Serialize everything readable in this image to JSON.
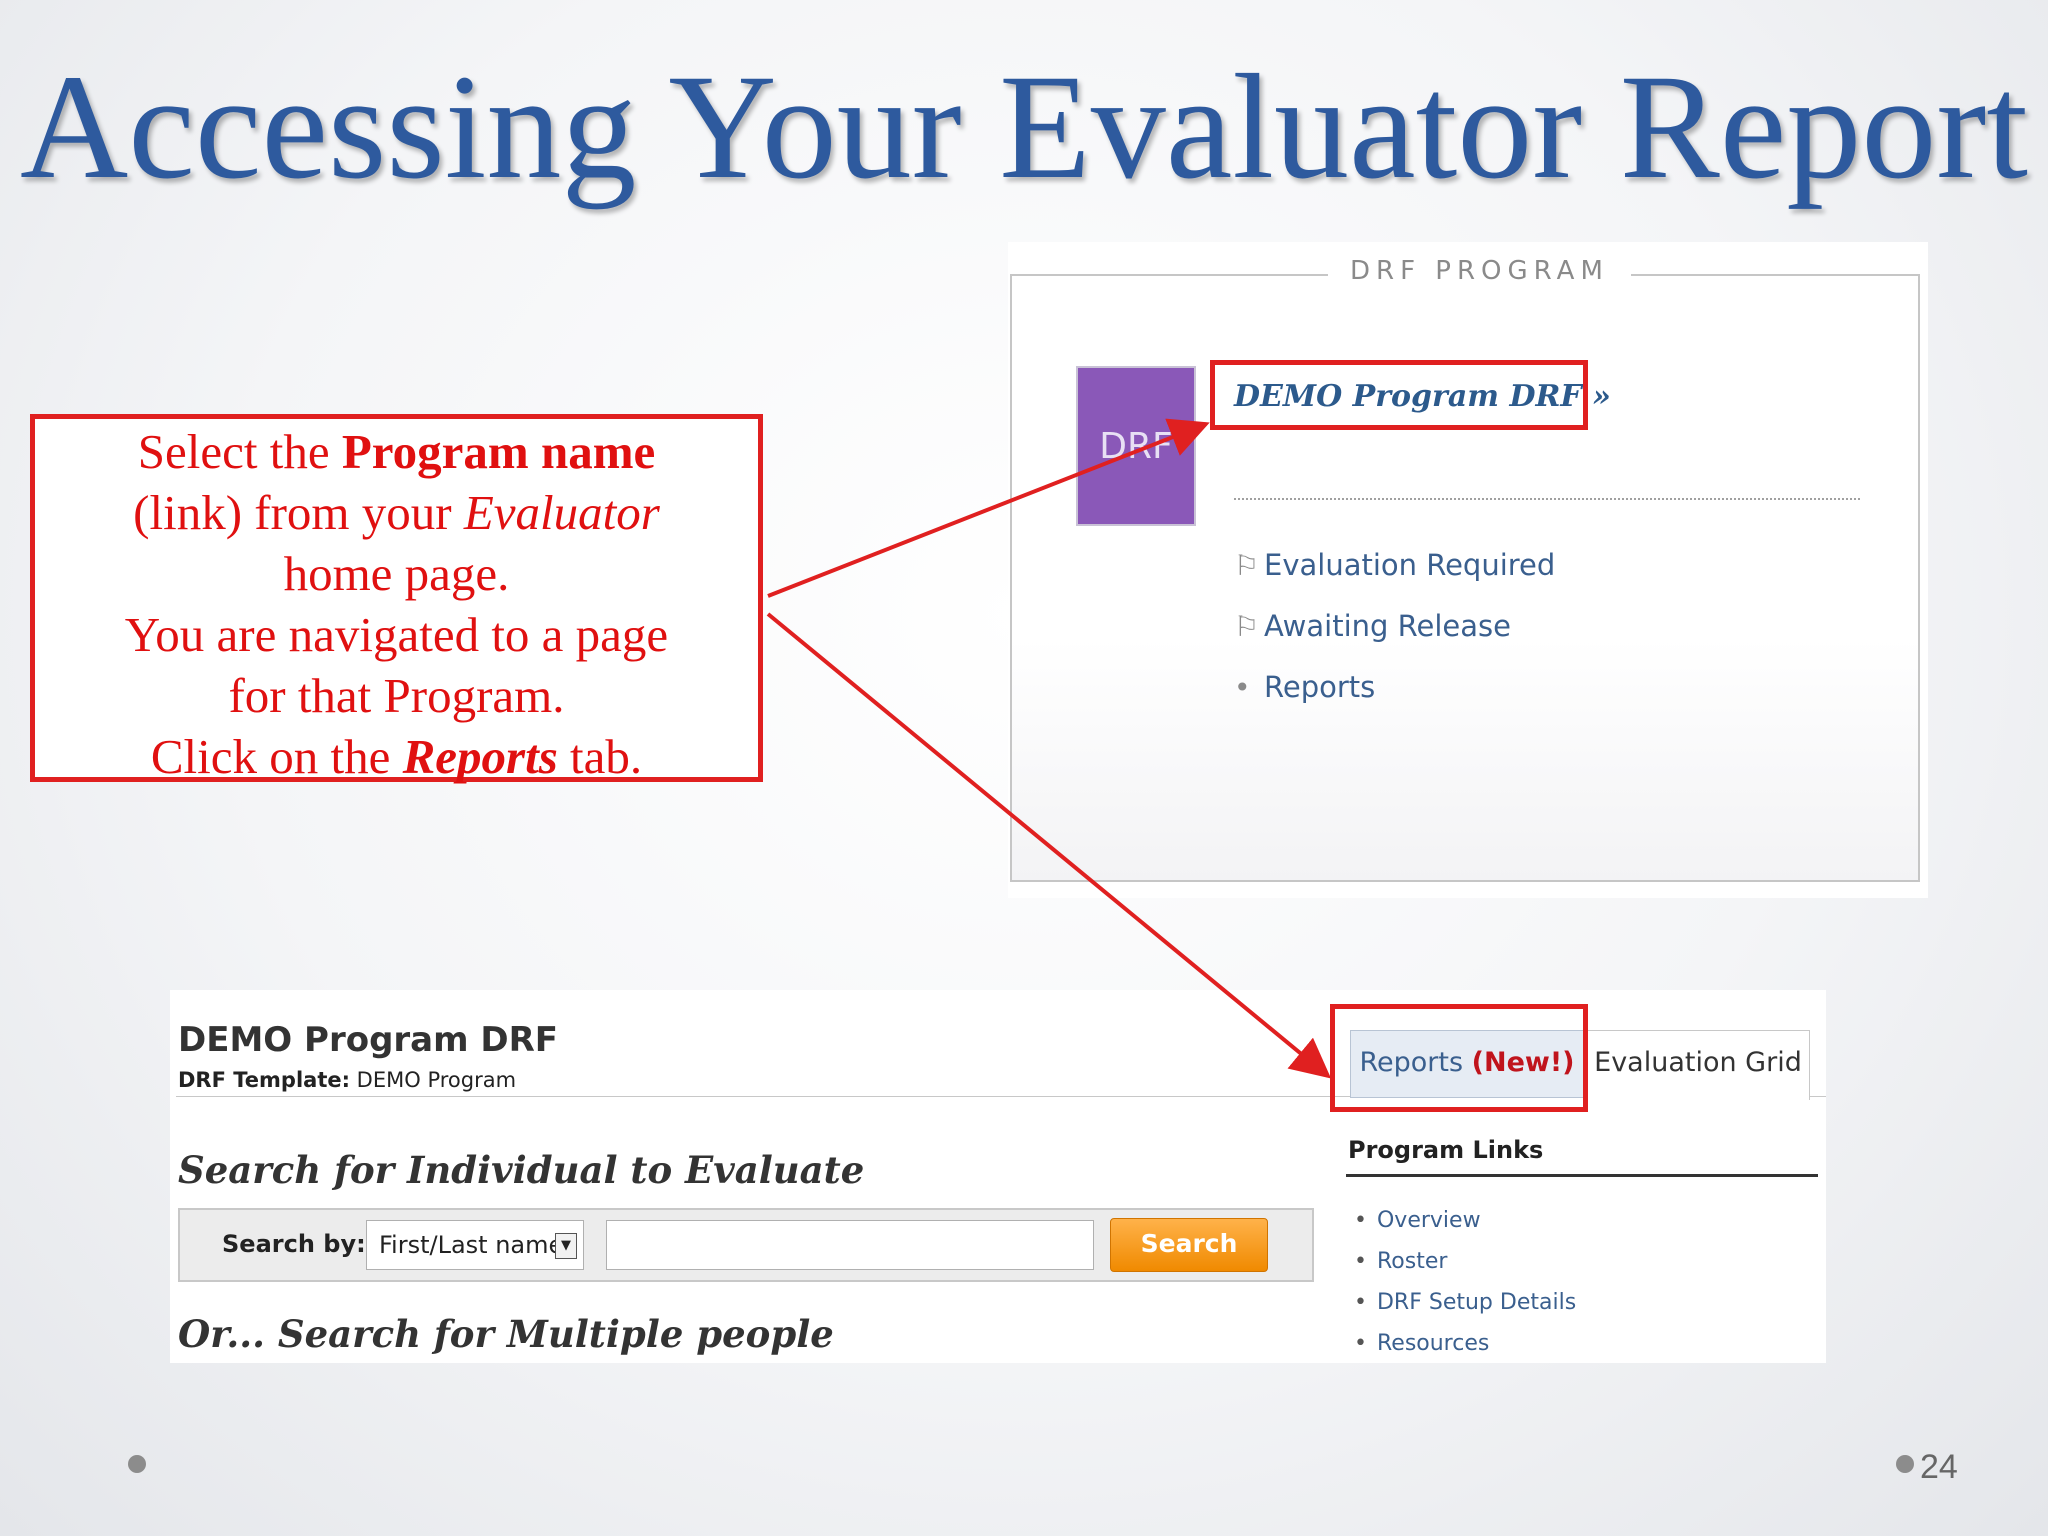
{
  "slide": {
    "title": "Accessing Your Evaluator Report",
    "page_number": "24"
  },
  "callout": {
    "line1_pre": "Select the ",
    "line1_bold": "Program name",
    "line2_pre": "(link) from your ",
    "line2_italic": "Evaluator",
    "line3": "home page.",
    "line4": "You are navigated to a page",
    "line5": "for that Program.",
    "line6_pre": "Click on the ",
    "line6_bold_italic": "Reports",
    "line6_post": " tab."
  },
  "drf_panel": {
    "legend": "DRF PROGRAM",
    "logo_text": "DRF",
    "program_link": "DEMO Program DRF »",
    "links": [
      {
        "label": "Evaluation Required",
        "icon": "flag-icon"
      },
      {
        "label": "Awaiting Release",
        "icon": "flag-icon"
      },
      {
        "label": "Reports",
        "icon": "bullet"
      }
    ]
  },
  "program_page": {
    "program_title": "DEMO Program DRF",
    "template_label": "DRF Template:",
    "template_value": " DEMO Program",
    "search_heading": "Search for Individual to Evaluate",
    "search_by_label": "Search by:",
    "search_by_value": "First/Last name",
    "search_input_value": "",
    "search_button": "Search",
    "multi_heading": "Or... Search for Multiple people",
    "tabs": {
      "reports_label": "Reports",
      "reports_badge": "(New!)",
      "eval_grid_label": "Evaluation Grid"
    },
    "program_links_title": "Program Links",
    "program_links": [
      "Overview",
      "Roster",
      "DRF Setup Details",
      "Resources"
    ]
  },
  "colors": {
    "title": "#2e5a9e",
    "callout_red": "#e01010",
    "highlight_red": "#e02020",
    "drf_purple": "#8a58b8",
    "link_blue": "#3a5f8e",
    "search_orange": "#f08a00"
  }
}
